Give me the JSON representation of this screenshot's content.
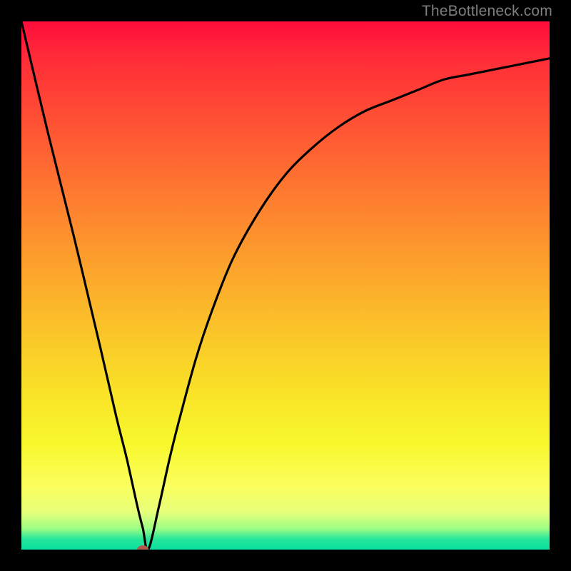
{
  "watermark": "TheBottleneck.com",
  "chart_data": {
    "type": "line",
    "title": "",
    "xlabel": "",
    "ylabel": "",
    "xlim": [
      0,
      100
    ],
    "ylim": [
      0,
      100
    ],
    "grid": false,
    "legend": false,
    "series": [
      {
        "name": "curve",
        "x": [
          0,
          5,
          10,
          15,
          18,
          20,
          22,
          23,
          24,
          26,
          28,
          30,
          33,
          36,
          40,
          45,
          50,
          55,
          60,
          65,
          70,
          75,
          80,
          85,
          90,
          95,
          100
        ],
        "y": [
          100,
          79,
          59,
          38,
          25,
          17,
          8,
          4,
          0,
          8,
          17,
          25,
          36,
          45,
          55,
          64,
          71,
          76,
          80,
          83,
          85,
          87,
          89,
          90,
          91,
          92,
          93
        ]
      }
    ],
    "marker": {
      "x": 23,
      "y": 0,
      "color": "#b25a4e"
    },
    "gradient_stops": [
      {
        "pos": 0,
        "color": "#ff0b3b"
      },
      {
        "pos": 70,
        "color": "#f9e227"
      },
      {
        "pos": 100,
        "color": "#0ae0a0"
      }
    ]
  }
}
